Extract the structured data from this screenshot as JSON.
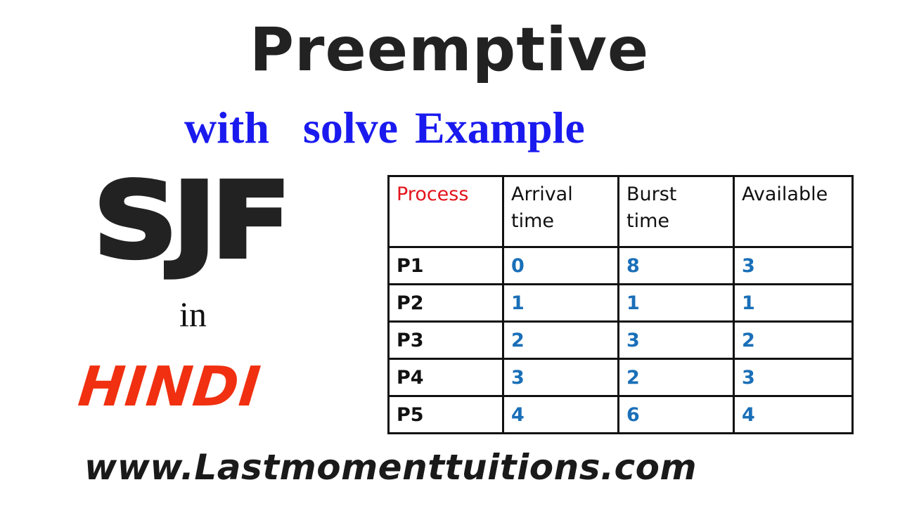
{
  "title": "Preemptive",
  "subtitle": "with  solve Example",
  "algorithm": "SJF",
  "connector": "in",
  "language": "HINDI",
  "website": "www.Lastmomenttuitions.com",
  "colors": {
    "title": "#222222",
    "subtitle": "#1a1aef",
    "language": "#f03010",
    "table_header_highlight": "#e3141c",
    "table_values": "#1a6fb8"
  },
  "table": {
    "headers": [
      "Process",
      "Arrival time",
      "Burst time",
      "Available"
    ],
    "rows": [
      {
        "process": "P1",
        "arrival": "0",
        "burst": "8",
        "available": "3"
      },
      {
        "process": "P2",
        "arrival": "1",
        "burst": "1",
        "available": "1"
      },
      {
        "process": "P3",
        "arrival": "2",
        "burst": "3",
        "available": "2"
      },
      {
        "process": "P4",
        "arrival": "3",
        "burst": "2",
        "available": "3"
      },
      {
        "process": "P5",
        "arrival": "4",
        "burst": "6",
        "available": "4"
      }
    ]
  }
}
